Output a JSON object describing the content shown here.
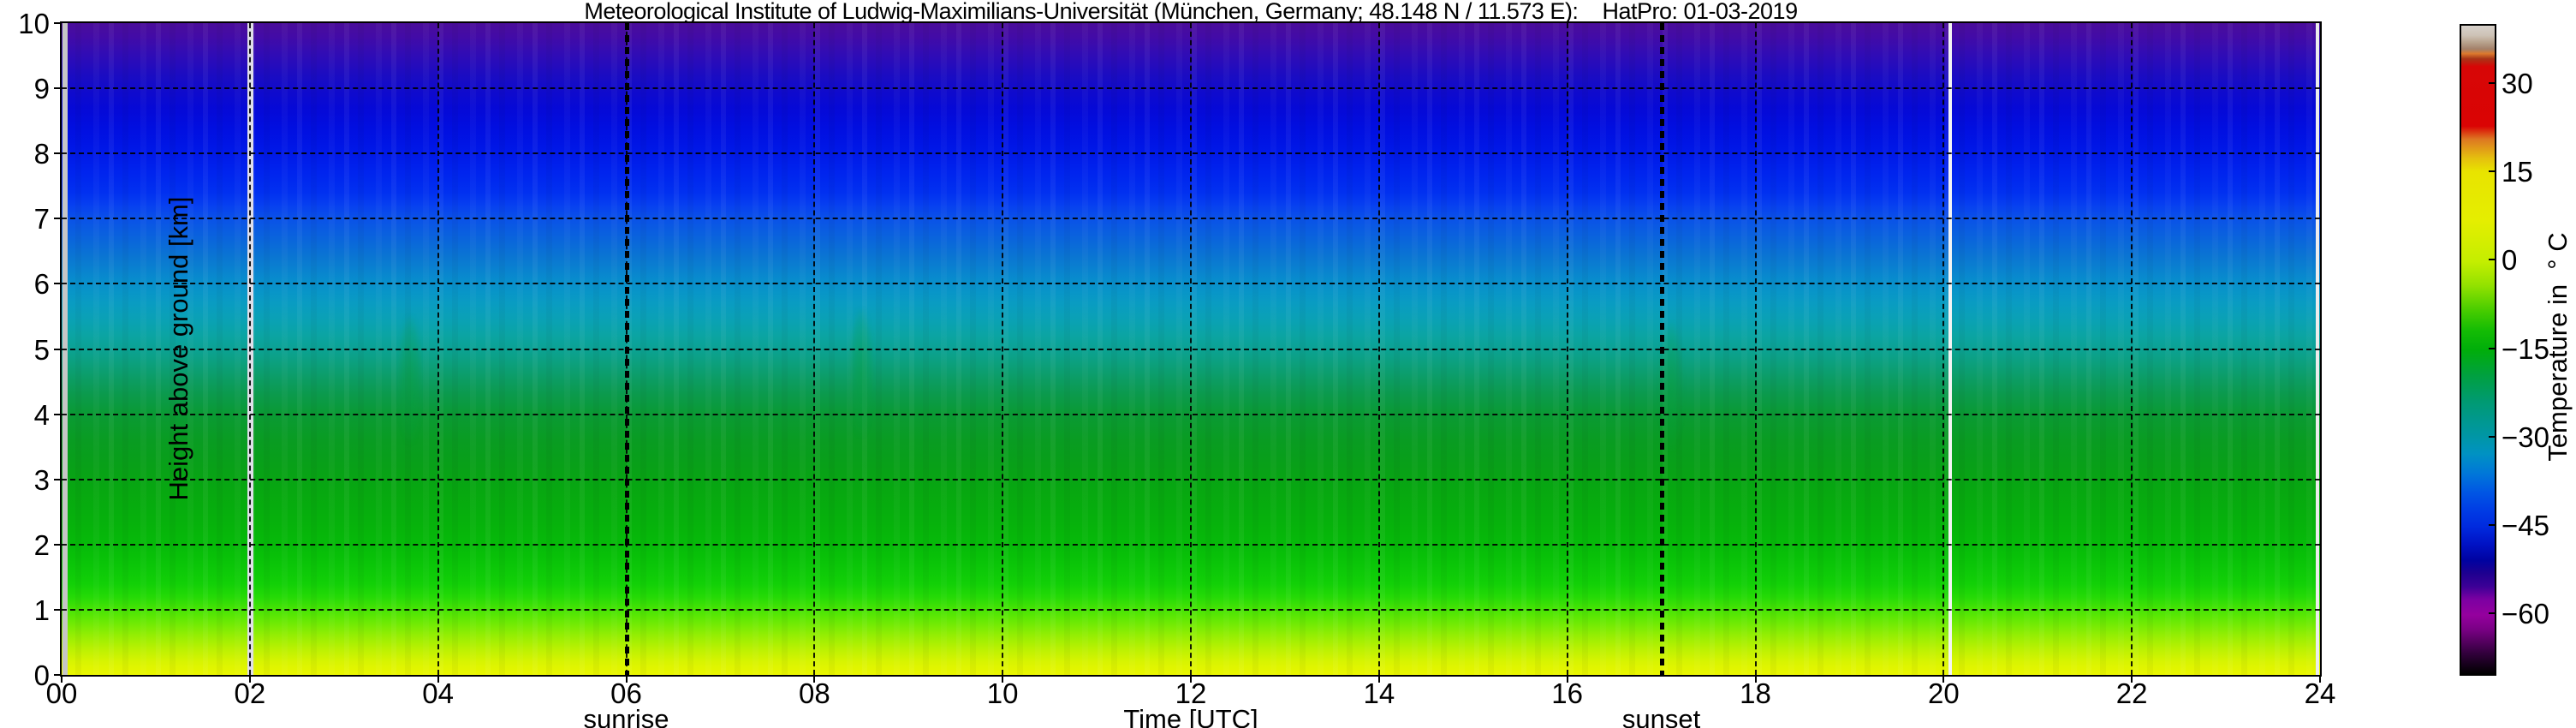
{
  "title": "Meteorological Institute of Ludwig-Maximilians-Universität (München, Germany; 48.148 N / 11.573 E):    HatPro: 01-03-2019",
  "axes": {
    "x": {
      "label": "Time [UTC]",
      "tick_labels": [
        "00",
        "02",
        "04",
        "06",
        "08",
        "10",
        "12",
        "14",
        "16",
        "18",
        "20",
        "22",
        "24"
      ],
      "tick_hours": [
        0,
        2,
        4,
        6,
        8,
        10,
        12,
        14,
        16,
        18,
        20,
        22,
        24
      ],
      "annotations": [
        {
          "label": "sunrise",
          "hour": 6
        },
        {
          "label": "sunset",
          "hour": 17
        }
      ]
    },
    "y": {
      "label": "Height above ground [km]",
      "ticks": [
        0,
        1,
        2,
        3,
        4,
        5,
        6,
        7,
        8,
        9,
        10
      ]
    }
  },
  "colorbar": {
    "label": "Temperature in  ° C",
    "ticks": [
      30,
      15,
      0,
      -15,
      -30,
      -45,
      -60
    ],
    "value_top": 40,
    "value_bottom": -70
  },
  "chart_data": {
    "type": "heatmap",
    "title": "Meteorological Institute of Ludwig-Maximilians-Universität (München, Germany; 48.148 N / 11.573 E):    HatPro: 01-03-2019",
    "instrument": "HatPro",
    "date": "01-03-2019",
    "xlabel": "Time [UTC]",
    "ylabel": "Height above ground [km]",
    "x_hours_range": [
      0,
      24
    ],
    "y_km_range": [
      0,
      10
    ],
    "colormap": "nipy_spectral",
    "colorbar_label": "Temperature in ° C",
    "colorbar_range_C": [
      -70,
      40
    ],
    "colorbar_tick_values_C": [
      30,
      15,
      0,
      -15,
      -30,
      -45,
      -60
    ],
    "temperature_profile": {
      "comment": "field is nearly horizontally uniform; mean vertical profile read from colors",
      "height_km": [
        0,
        0.5,
        1,
        1.5,
        2,
        2.5,
        3,
        3.5,
        4,
        4.5,
        5,
        5.5,
        6,
        6.5,
        7,
        7.5,
        8,
        8.5,
        9,
        9.5,
        10
      ],
      "temp_C": [
        9,
        5,
        1,
        -6,
        -10,
        -12,
        -14,
        -17,
        -20,
        -24,
        -29,
        -33,
        -37,
        -41,
        -45,
        -49,
        -52,
        -55,
        -58,
        -61,
        -63
      ]
    },
    "events": {
      "sunrise_hour": 6,
      "sunset_hour": 17,
      "data_gap_hours": [
        2.0,
        20.07
      ]
    },
    "anomaly_streaks": [
      {
        "hour": 3.7,
        "height_km": 4.6
      },
      {
        "hour": 8.5,
        "height_km": 4.7
      },
      {
        "hour": 17.1,
        "height_km": 4.5
      }
    ]
  },
  "colors": {
    "background": "#ffffff",
    "gridline": "rgba(0,0,0,0.9)",
    "gap_lines": [
      "#dfdee8",
      "#f4f4f4"
    ],
    "left_edge_gap": "#c6c6c6",
    "right_edge_gap": "#ececec",
    "plot_gradient_top_to_bottom": [
      [
        0,
        "#4a0d9a"
      ],
      [
        2,
        "#430ba6"
      ],
      [
        5,
        "#2f0cb6"
      ],
      [
        8,
        "#1b0cc2"
      ],
      [
        10,
        "#120bca"
      ],
      [
        13,
        "#0609d6"
      ],
      [
        16,
        "#010ee0"
      ],
      [
        20,
        "#0019e8"
      ],
      [
        23,
        "#0024ee"
      ],
      [
        26,
        "#0130f0"
      ],
      [
        28,
        "#0740f0"
      ],
      [
        30,
        "#0a52e8"
      ],
      [
        33,
        "#0a64dc"
      ],
      [
        36,
        "#0a76d2"
      ],
      [
        40,
        "#0890cc"
      ],
      [
        43,
        "#099cc2"
      ],
      [
        46,
        "#0aa2b2"
      ],
      [
        48,
        "#0ba4a2"
      ],
      [
        50,
        "#0ba294"
      ],
      [
        52,
        "#0ca07f"
      ],
      [
        55,
        "#0c9c60"
      ],
      [
        57,
        "#0b9a4c"
      ],
      [
        60,
        "#0a9a34"
      ],
      [
        64,
        "#099c22"
      ],
      [
        68,
        "#08a018"
      ],
      [
        72,
        "#07a810"
      ],
      [
        76,
        "#06b00c"
      ],
      [
        80,
        "#06ba09"
      ],
      [
        83,
        "#0ac508"
      ],
      [
        86,
        "#12d007"
      ],
      [
        88,
        "#24da06"
      ],
      [
        90,
        "#48e405"
      ],
      [
        92,
        "#6eea04"
      ],
      [
        94,
        "#96ee03"
      ],
      [
        96,
        "#baf102"
      ],
      [
        98,
        "#d8f401"
      ],
      [
        100,
        "#eaf600"
      ]
    ],
    "colorbar_gradient_top_to_bottom": [
      [
        0,
        "#d7d1cb"
      ],
      [
        1.5,
        "#cdc2b6"
      ],
      [
        2.6,
        "#b7a18c"
      ],
      [
        3.6,
        "#a3816a"
      ],
      [
        4.3,
        "#dc7a2e"
      ],
      [
        5.1,
        "#a83517"
      ],
      [
        6.3,
        "#d70606"
      ],
      [
        15.5,
        "#da0404"
      ],
      [
        17.5,
        "#dd7722"
      ],
      [
        20.5,
        "#e5c10e"
      ],
      [
        22.5,
        "#e8e400"
      ],
      [
        30,
        "#e5ee00"
      ],
      [
        36.4,
        "#c4ee00"
      ],
      [
        40,
        "#94e200"
      ],
      [
        44,
        "#46cc00"
      ],
      [
        47,
        "#14bc04"
      ],
      [
        50,
        "#00ae0a"
      ],
      [
        54,
        "#00a040"
      ],
      [
        58,
        "#009a72"
      ],
      [
        61,
        "#009890"
      ],
      [
        63.6,
        "#0096a8"
      ],
      [
        66,
        "#0092c2"
      ],
      [
        69,
        "#0078d8"
      ],
      [
        72,
        "#0056e4"
      ],
      [
        75,
        "#003ae4"
      ],
      [
        77.3,
        "#002ade"
      ],
      [
        80,
        "#0012c4"
      ],
      [
        82.5,
        "#0002a0"
      ],
      [
        84.5,
        "#1e0090"
      ],
      [
        86.5,
        "#3c0096"
      ],
      [
        88.5,
        "#7c00a2"
      ],
      [
        90.9,
        "#95009e"
      ],
      [
        93,
        "#7b0086"
      ],
      [
        95,
        "#550060"
      ],
      [
        97,
        "#2e0038"
      ],
      [
        100,
        "#000000"
      ]
    ]
  }
}
